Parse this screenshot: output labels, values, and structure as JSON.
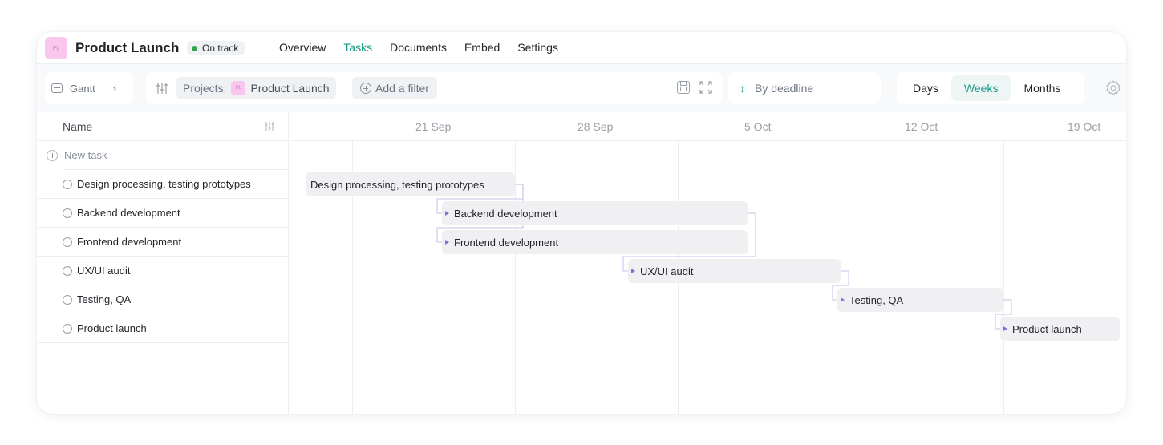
{
  "project": {
    "avatar_text": "PL",
    "title": "Product Launch",
    "status": "On track",
    "status_color": "#2fa84f"
  },
  "nav": {
    "items": [
      "Overview",
      "Tasks",
      "Documents",
      "Embed",
      "Settings"
    ],
    "active": "Tasks"
  },
  "toolbar": {
    "view_label": "Gantt",
    "filter_projects_label": "Projects:",
    "filter_projects_avatar": "PL",
    "filter_projects_value": "Product Launch",
    "add_filter_label": "Add a filter",
    "sort_label": "By deadline",
    "scale_options": [
      "Days",
      "Weeks",
      "Months"
    ],
    "scale_active": "Weeks"
  },
  "list": {
    "column_name": "Name",
    "new_task_label": "New task"
  },
  "tasks": [
    {
      "name": "Design processing, testing prototypes"
    },
    {
      "name": "Backend development"
    },
    {
      "name": "Frontend development"
    },
    {
      "name": "UX/UI audit"
    },
    {
      "name": "Testing, QA"
    },
    {
      "name": "Product launch"
    }
  ],
  "timeline": {
    "weeks": [
      "21 Sep",
      "28 Sep",
      "5 Oct",
      "12 Oct",
      "19 Oct"
    ]
  },
  "colors": {
    "accent": "#179a8a",
    "dependency": "#7a73e0",
    "avatar_bg": "#f9c7ee"
  }
}
